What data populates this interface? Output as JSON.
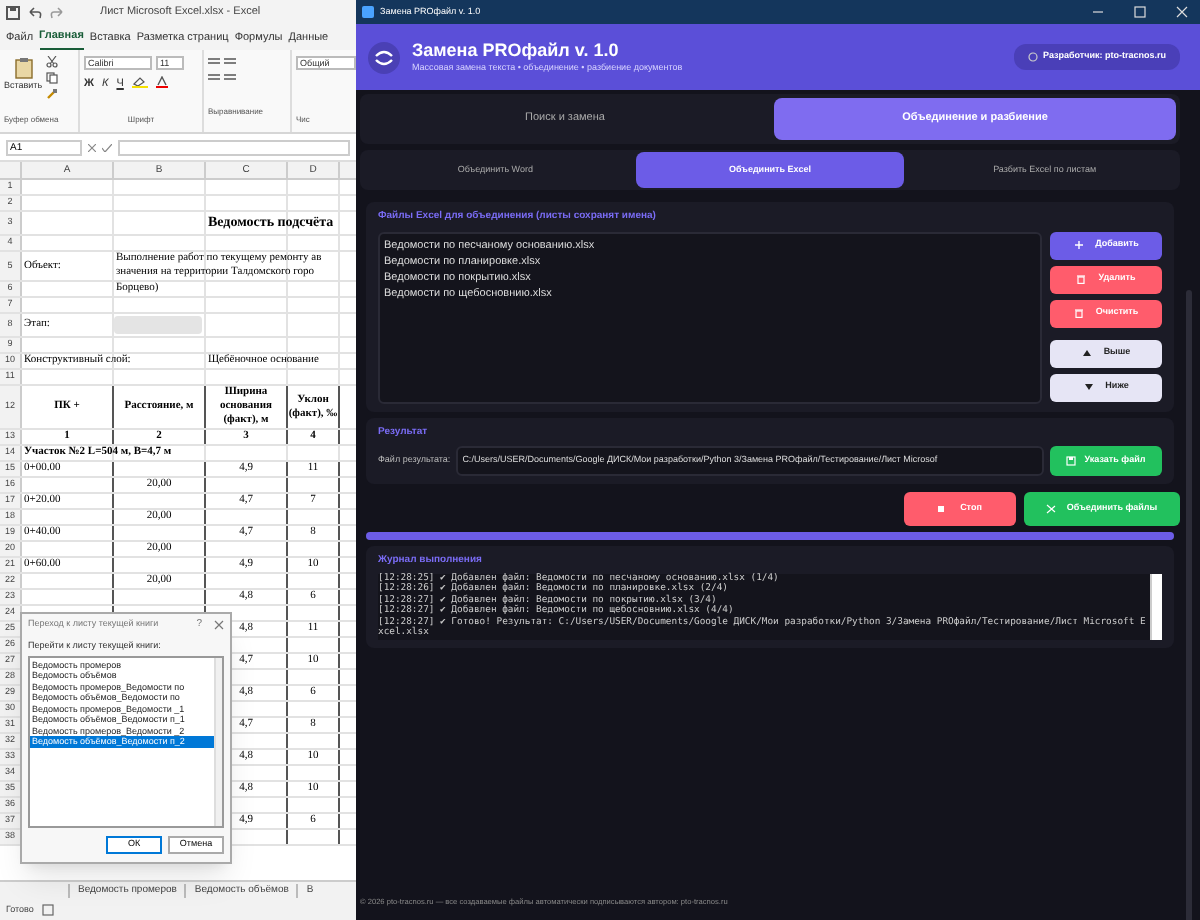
{
  "excel": {
    "title": "Лист Microsoft Excel.xlsx  -  Excel",
    "ribbon_tabs": [
      {
        "label": "Файл",
        "selected": false
      },
      {
        "label": "Главная",
        "selected": true
      },
      {
        "label": "Вставка",
        "selected": false
      },
      {
        "label": "Разметка страниц",
        "selected": false
      },
      {
        "label": "Формулы",
        "selected": false
      },
      {
        "label": "Данные",
        "selected": false
      }
    ],
    "paste": "Вставить",
    "font_name": "Calibri",
    "font_size": "11",
    "font_styles": [
      "Ж",
      "К",
      "Ч"
    ],
    "number_format": "Общий",
    "groups": [
      "Буфер обмена",
      "Шрифт",
      "Выравнивание",
      "Чис"
    ],
    "name_box": "A1",
    "columns": [
      "A",
      "B",
      "C",
      "D"
    ],
    "rows": [
      {
        "n": "1",
        "kind": "plain"
      },
      {
        "n": "2",
        "kind": "plain"
      },
      {
        "n": "3",
        "kind": "title",
        "c": "Ведомость подсчёта"
      },
      {
        "n": "4",
        "kind": "plain"
      },
      {
        "n": "5",
        "kind": "plain",
        "a": "Объект:",
        "b": [
          "Выполнение работ по текущему ремонту ав",
          "значения на территории Талдомского горо"
        ]
      },
      {
        "n": "6",
        "kind": "plain",
        "b": "Борцево)"
      },
      {
        "n": "7",
        "kind": "plain"
      },
      {
        "n": "8",
        "kind": "plain",
        "a": "Этап:",
        "blurred": true
      },
      {
        "n": "9",
        "kind": "plain"
      },
      {
        "n": "10",
        "kind": "plain",
        "a": "Конструктивный слой:",
        "c": "Щебёночное основание"
      },
      {
        "n": "11",
        "kind": "plain"
      },
      {
        "n": "12",
        "kind": "header",
        "a": "ПК +",
        "b": "Расстояние, м",
        "c": "Ширина основания (факт), м",
        "d": "Уклон (факт), ‰"
      },
      {
        "n": "13",
        "kind": "header",
        "a": "1",
        "b": "2",
        "c": "3",
        "d": "4"
      },
      {
        "n": "14",
        "kind": "section",
        "a": "Участок №2 L=504 м, B=4,7 м"
      },
      {
        "n": "15",
        "kind": "data",
        "a": "0+00.00",
        "c": "4,9",
        "d": "11"
      },
      {
        "n": "16",
        "kind": "data",
        "b": "20,00"
      },
      {
        "n": "17",
        "kind": "data",
        "a": "0+20.00",
        "c": "4,7",
        "d": "7"
      },
      {
        "n": "18",
        "kind": "data",
        "b": "20,00"
      },
      {
        "n": "19",
        "kind": "data",
        "a": "0+40.00",
        "c": "4,7",
        "d": "8"
      },
      {
        "n": "20",
        "kind": "data",
        "b": "20,00"
      },
      {
        "n": "21",
        "kind": "data",
        "a": "0+60.00",
        "c": "4,9",
        "d": "10"
      },
      {
        "n": "22",
        "kind": "data",
        "b": "20,00"
      },
      {
        "n": "23",
        "kind": "data",
        "c": "4,8",
        "d": "6"
      },
      {
        "n": "24",
        "kind": "data"
      },
      {
        "n": "25",
        "kind": "data",
        "c": "4,8",
        "d": "11"
      },
      {
        "n": "26",
        "kind": "data"
      },
      {
        "n": "27",
        "kind": "data",
        "c": "4,7",
        "d": "10"
      },
      {
        "n": "28",
        "kind": "data"
      },
      {
        "n": "29",
        "kind": "data",
        "c": "4,8",
        "d": "6"
      },
      {
        "n": "30",
        "kind": "data"
      },
      {
        "n": "31",
        "kind": "data",
        "c": "4,7",
        "d": "8"
      },
      {
        "n": "32",
        "kind": "data"
      },
      {
        "n": "33",
        "kind": "data",
        "c": "4,8",
        "d": "10"
      },
      {
        "n": "34",
        "kind": "data"
      },
      {
        "n": "35",
        "kind": "data",
        "c": "4,8",
        "d": "10"
      },
      {
        "n": "36",
        "kind": "data"
      },
      {
        "n": "37",
        "kind": "data",
        "c": "4,9",
        "d": "6"
      },
      {
        "n": "38",
        "kind": "data"
      }
    ],
    "sheet_tabs": [
      "Ведомость промеров",
      "Ведомость объёмов",
      "В"
    ],
    "status": "Готово"
  },
  "goto_dialog": {
    "title": "Переход к листу текущей книги",
    "help": "?",
    "label": "Перейти к листу текущей книги:",
    "sheets": [
      {
        "label": "Ведомость промеров",
        "selected": false
      },
      {
        "label": "Ведомость объёмов",
        "selected": false
      },
      {
        "label": "Ведомость промеров_Ведомости по",
        "selected": false
      },
      {
        "label": "Ведомость объёмов_Ведомости по",
        "selected": false
      },
      {
        "label": "Ведомость промеров_Ведомости _1",
        "selected": false
      },
      {
        "label": "Ведомость объёмов_Ведомости п_1",
        "selected": false
      },
      {
        "label": "Ведомость промеров_Ведомости _2",
        "selected": false
      },
      {
        "label": "Ведомость объёмов_Ведомости п_2",
        "selected": true
      }
    ],
    "buttons": [
      "ОК",
      "Отмена"
    ]
  },
  "app": {
    "window_title": "Замена PROфайл v. 1.0",
    "title": "Замена PROфайл v. 1.0",
    "subtitle": "Массовая замена текста • объединение • разбиение документов",
    "developer": "Разработчик: pto-tracnos.ru",
    "tabs": [
      {
        "label": "Поиск и замена",
        "selected": false
      },
      {
        "label": "Объединение и разбиение",
        "selected": true
      }
    ],
    "subtabs": [
      {
        "label": "Объединить Word",
        "selected": false
      },
      {
        "label": "Объединить Excel",
        "selected": true
      },
      {
        "label": "Разбить Excel по листам",
        "selected": false
      }
    ],
    "files": {
      "title": "Файлы Excel для объединения (листы сохранят имена)",
      "items": [
        "Ведомости по песчаному основанию.xlsx",
        "Ведомости по планировке.xlsx",
        "Ведомости по покрытию.xlsx",
        "Ведомости по щебосновнию.xlsx"
      ],
      "buttons": [
        {
          "label": "Добавить",
          "kind": "add"
        },
        {
          "label": "Удалить",
          "kind": "delete"
        },
        {
          "label": "Очистить",
          "kind": "delete"
        },
        {
          "label": "Выше",
          "kind": "up"
        },
        {
          "label": "Ниже",
          "kind": "down"
        }
      ]
    },
    "result": {
      "title": "Результат",
      "label": "Файл результата:",
      "value": "C:/Users/USER/Documents/Google ДИСК/Мои разработки/Python 3/Замена PROфайл/Тестирование/Лист Microsof",
      "button": "Указать файл"
    },
    "stop": "Стоп",
    "merge": "Объединить файлы",
    "progress": {
      "level": 1
    },
    "log": {
      "title": "Журнал выполнения",
      "lines": [
        "[12:28:25] ✔ Добавлен файл: Ведомости по песчаному основанию.xlsx (1/4)",
        "[12:28:26] ✔ Добавлен файл: Ведомости по планировке.xlsx (2/4)",
        "[12:28:27] ✔ Добавлен файл: Ведомости по покрытию.xlsx (3/4)",
        "[12:28:27] ✔ Добавлен файл: Ведомости по щебосновнию.xlsx (4/4)",
        "[12:28:27] ✔ Готово! Результат: C:/Users/USER/Documents/Google ДИСК/Мои разработки/Python 3/Замена PROфайл/Тестирование/Лист Microsoft Excel.xlsx"
      ]
    },
    "footer": "© 2026 pto-tracnos.ru — все создаваемые файлы автоматически подписываются автором: pto-tracnos.ru"
  }
}
